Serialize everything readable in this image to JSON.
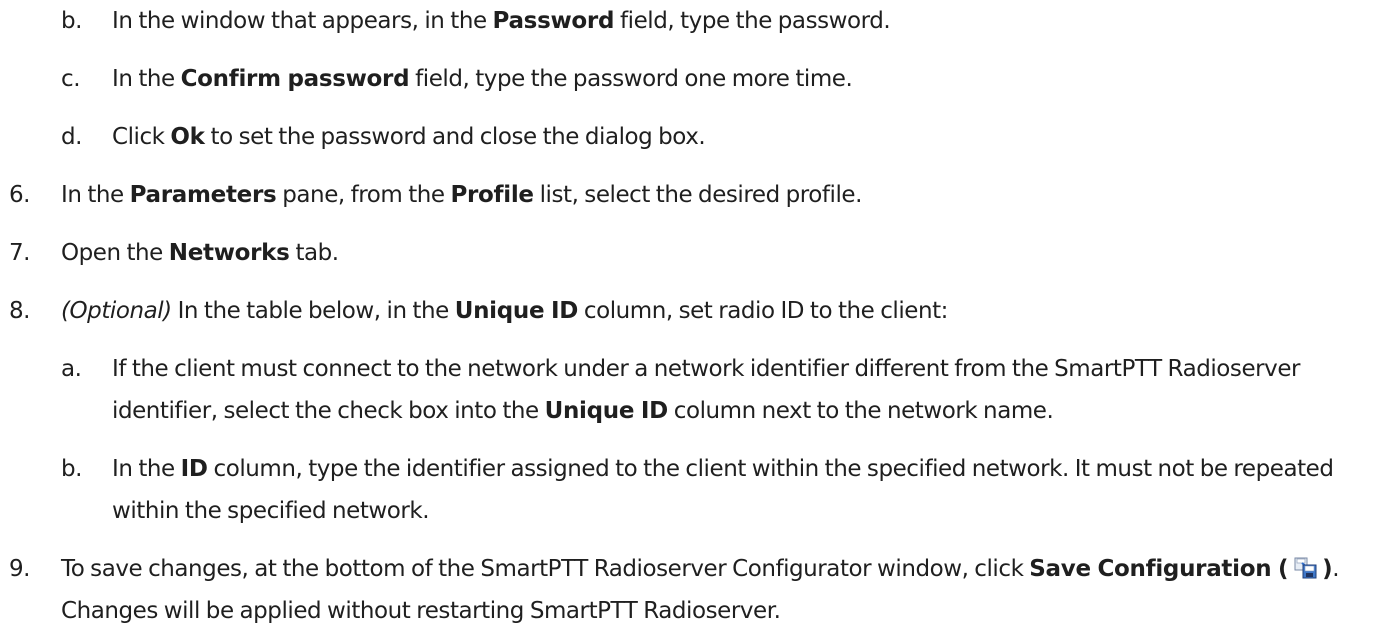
{
  "steps": [
    {
      "marker": "b.",
      "parts": [
        "In the window that appears, in the ",
        "Password",
        " field, type the password."
      ]
    },
    {
      "marker": "c.",
      "parts": [
        "In the ",
        "Confirm password",
        " field, type the password one more time."
      ]
    },
    {
      "marker": "d.",
      "parts": [
        "Click ",
        "Ok",
        " to set the password and close the dialog box."
      ]
    },
    {
      "marker": "6.",
      "parts": [
        "In the ",
        "Parameters",
        " pane, from the ",
        "Profile",
        " list, select the desired profile."
      ]
    },
    {
      "marker": "7.",
      "parts": [
        "Open the ",
        "Networks",
        " tab."
      ]
    },
    {
      "marker": "8.",
      "parts": [
        "(Optional)",
        " In the table below, in the ",
        "Unique ID",
        " column, set radio ID to the client:"
      ]
    },
    {
      "marker": "a.",
      "parts": [
        "If the client must connect to the network under a network identifier different from the SmartPTT Radioserver identifier, select the check box into the ",
        "Unique ID",
        " column next to the network name."
      ]
    },
    {
      "marker": "b.",
      "parts": [
        "In the ",
        "ID",
        " column, type the identifier assigned to the client within the specified network. It must not be repeated within the specified network."
      ]
    },
    {
      "marker": "9.",
      "parts": [
        "To save changes, at the bottom of the SmartPTT Radioserver Configurator window, click ",
        "Save Configuration (",
        " ",
        ")",
        ". Changes will be applied without restarting SmartPTT Radioserver."
      ]
    }
  ],
  "icons": {
    "save_configuration": "save-configuration-icon"
  }
}
